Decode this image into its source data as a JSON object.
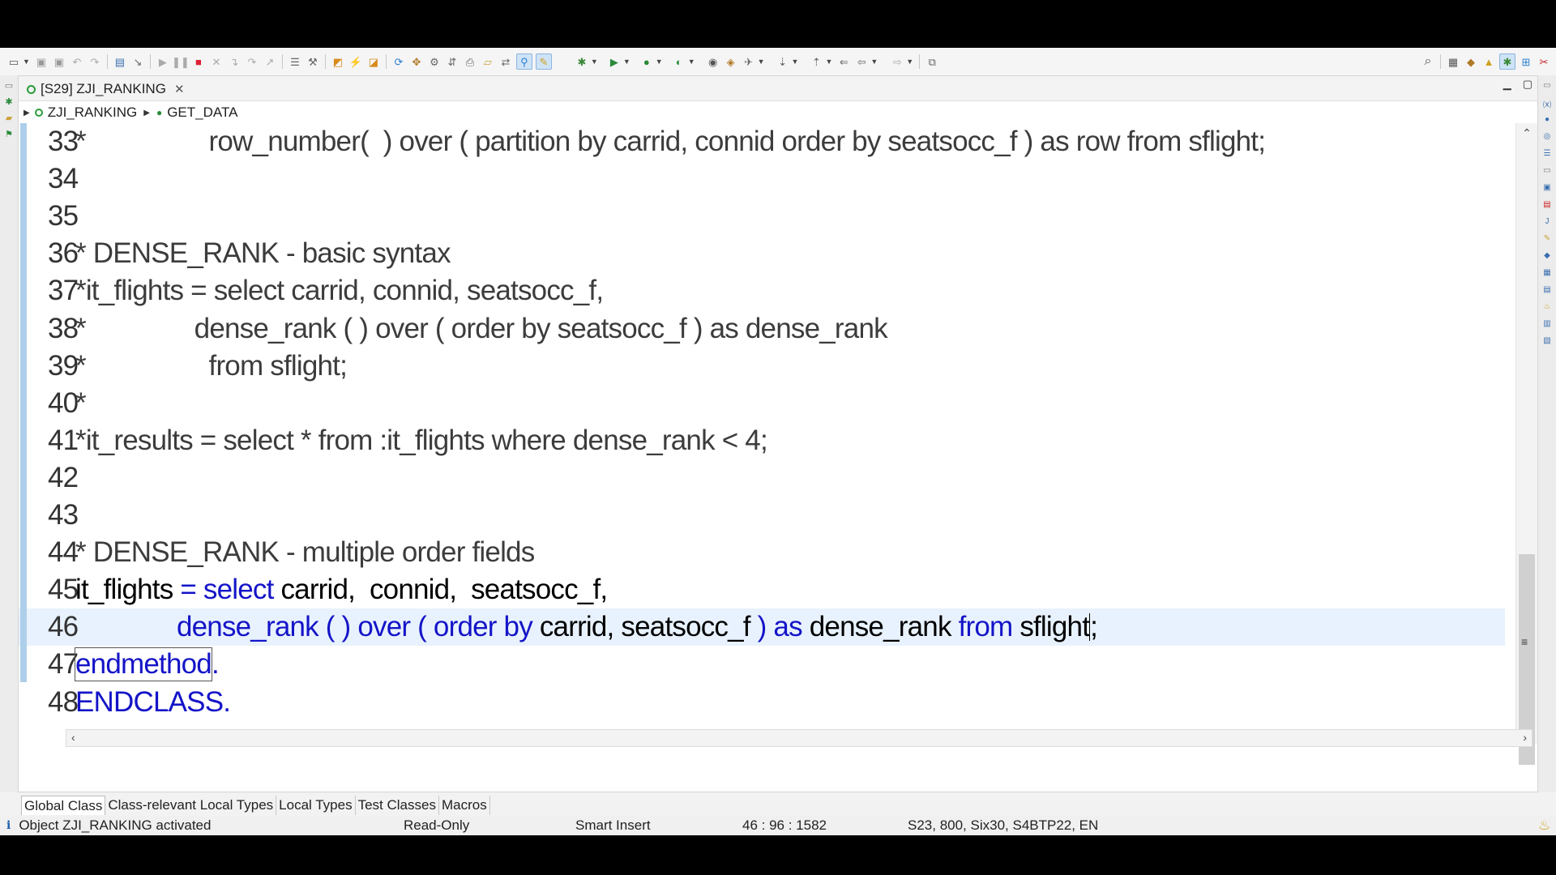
{
  "toolbar": {
    "icons": [
      "new-icon",
      "save-icon",
      "save-all-icon",
      "undo-icon",
      "redo-icon",
      "display-icon",
      "run-icon",
      "pause-icon",
      "stop-icon",
      "disconnect-icon",
      "step-icon",
      "outline-icon",
      "format-icon",
      "open-icon",
      "activate-icon",
      "check-icon",
      "search-icon",
      "perspective-icon"
    ]
  },
  "editor": {
    "tab_label": "[S29] ZJI_RANKING",
    "breadcrumb": {
      "class": "ZJI_RANKING",
      "method": "GET_DATA"
    }
  },
  "code_lines": [
    {
      "num": "33",
      "segments": [
        {
          "t": "*                 row_number(  ) over ( partition by carrid, connid order by seatsocc_f ) as row from sflight;",
          "c": "txt"
        }
      ]
    },
    {
      "num": "34",
      "segments": []
    },
    {
      "num": "35",
      "segments": []
    },
    {
      "num": "36",
      "segments": [
        {
          "t": "* DENSE_RANK - basic syntax",
          "c": "txt"
        }
      ]
    },
    {
      "num": "37",
      "segments": [
        {
          "t": "*it_flights = select carrid, connid, seatsocc_f,",
          "c": "txt"
        }
      ]
    },
    {
      "num": "38",
      "segments": [
        {
          "t": "*               dense_rank ( ) over ( order by seatsocc_f ) as dense_rank",
          "c": "txt"
        }
      ]
    },
    {
      "num": "39",
      "segments": [
        {
          "t": "*                 from sflight;",
          "c": "txt"
        }
      ]
    },
    {
      "num": "40",
      "segments": [
        {
          "t": "*",
          "c": "txt"
        }
      ]
    },
    {
      "num": "41",
      "segments": [
        {
          "t": "*it_results = select * from :it_flights where dense_rank < 4;",
          "c": "txt"
        }
      ]
    },
    {
      "num": "42",
      "segments": []
    },
    {
      "num": "43",
      "segments": []
    },
    {
      "num": "44",
      "segments": [
        {
          "t": "* DENSE_RANK - multiple order fields",
          "c": "txt"
        }
      ]
    },
    {
      "num": "45",
      "segments": [
        {
          "t": "it_flights ",
          "c": "plain"
        },
        {
          "t": "= select ",
          "c": "kw"
        },
        {
          "t": "carrid, ",
          "c": "plain"
        },
        {
          "t": " connid, ",
          "c": "plain"
        },
        {
          "t": " seatsocc_f,",
          "c": "plain"
        }
      ]
    },
    {
      "num": "46",
      "segments": [
        {
          "t": "              dense_rank ( ) over ( order by ",
          "c": "kw"
        },
        {
          "t": "carrid, seatsocc_f ",
          "c": "plain"
        },
        {
          "t": ") as ",
          "c": "kw"
        },
        {
          "t": "dense_rank ",
          "c": "plain"
        },
        {
          "t": "from ",
          "c": "kw"
        },
        {
          "t": "sflight",
          "c": "plain"
        },
        {
          "t": "|",
          "c": "caret"
        },
        {
          "t": ";",
          "c": "plain"
        }
      ]
    },
    {
      "num": "47",
      "segments": [
        {
          "t": "endmethod",
          "c": "kw boxed"
        },
        {
          "t": ".",
          "c": "kw"
        }
      ]
    },
    {
      "num": "48",
      "segments": [
        {
          "t": "ENDCLASS.",
          "c": "kw"
        }
      ]
    }
  ],
  "bottom_tabs": [
    "Global Class",
    "Class-relevant Local Types",
    "Local Types",
    "Test Classes",
    "Macros"
  ],
  "status": {
    "message": "Object ZJI_RANKING activated",
    "mode": "Read-Only",
    "insert": "Smart Insert",
    "position": "46 : 96 : 1582",
    "system": "S23, 800, Six30, S4BTP22, EN"
  }
}
